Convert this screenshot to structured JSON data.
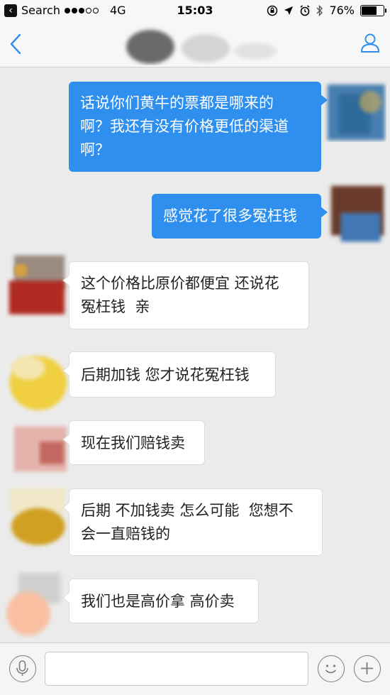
{
  "status_bar": {
    "back_app": "Search",
    "network": "4G",
    "time": "15:03",
    "battery_percent": "76%",
    "battery_level": 0.76
  },
  "nav": {
    "back_icon": "chevron-left-icon",
    "profile_icon": "person-icon",
    "accent": "#2f8fef"
  },
  "messages": [
    {
      "side": "out",
      "text": "话说你们黄牛的票都是哪来的\n啊？我还有没有价格更低的渠道\n啊？"
    },
    {
      "side": "out",
      "text": "感觉花了很多冤枉钱"
    },
    {
      "side": "in",
      "text": "这个价格比原价都便宜 还说花\n冤枉钱  亲"
    },
    {
      "side": "in",
      "text": "后期加钱 您才说花冤枉钱"
    },
    {
      "side": "in",
      "text": "现在我们赔钱卖"
    },
    {
      "side": "in",
      "text": "后期 不加钱卖 怎么可能  您想不\n会一直赔钱的"
    },
    {
      "side": "in",
      "text": "我们也是高价拿 高价卖"
    }
  ],
  "input_bar": {
    "placeholder": "",
    "voice_icon": "microphone-icon",
    "emoji_icon": "smiley-icon",
    "add_icon": "plus-icon"
  },
  "colors": {
    "outgoing_bubble": "#2f8fef",
    "incoming_bubble": "#ffffff",
    "chat_background": "#ebebeb"
  }
}
